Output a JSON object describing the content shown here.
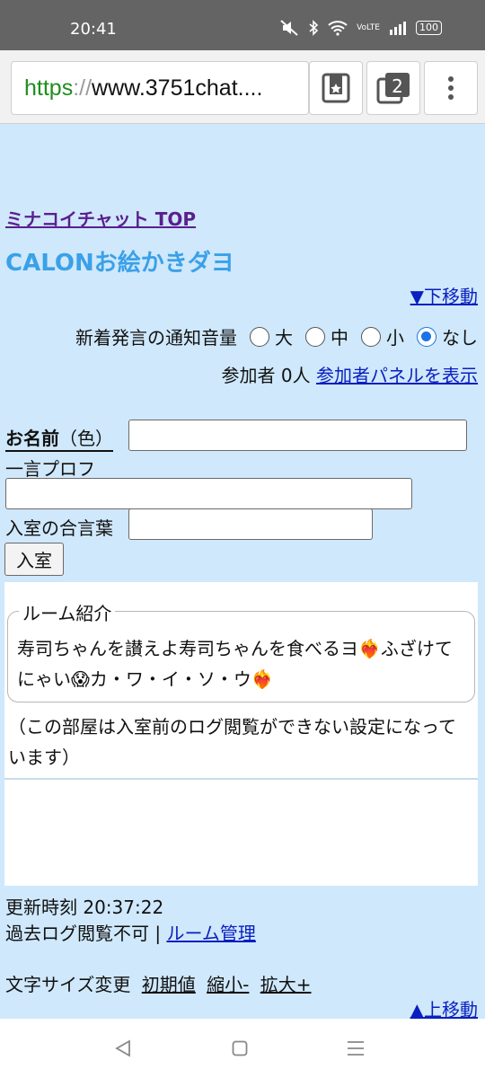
{
  "status_bar": {
    "time": "20:41",
    "battery": "100",
    "icons": [
      "mute-icon",
      "bluetooth-icon",
      "wifi-icon",
      "lte-icon",
      "signal-icon",
      "battery-icon"
    ]
  },
  "browser": {
    "url_scheme": "https",
    "url_sep": "://",
    "url_rest": "www.3751chat....",
    "tab_count": "2"
  },
  "page": {
    "top_link": "ミナコイチャット TOP",
    "room_title": "CALONお絵かきダヨ",
    "down_link": "▼下移動",
    "notify_label": "新着発言の通知音量",
    "volume_options": [
      "大",
      "中",
      "小",
      "なし"
    ],
    "volume_selected": "なし",
    "participants_text": "参加者 0人",
    "participants_link": "参加者パネルを表示",
    "name_label_bold": "お名前",
    "name_label_color": "（色）",
    "name_value": "",
    "prof_label": "一言プロフ",
    "prof_value": "",
    "password_label": "入室の合言葉",
    "password_value": "",
    "enter_button": "入室",
    "room_intro_legend": "ルーム紹介",
    "room_intro_text": "寿司ちゃんを讃えよ寿司ちゃんを食べるヨ❤️‍🔥ふざけてにゃい😱カ・ワ・イ・ソ・ウ❤️‍🔥",
    "log_note": "（この部屋は入室前のログ閲覧ができない設定になっています）",
    "updated_text": "更新時刻 20:37:22",
    "log_text": "過去ログ閲覧不可 | ",
    "room_admin_link": "ルーム管理",
    "font_size_label": "文字サイズ変更",
    "font_size_reset": "初期値",
    "font_size_smaller": "縮小-",
    "font_size_larger": "拡大+",
    "up_link": "▲上移動"
  },
  "colors": {
    "page_bg": "#cfe8fb",
    "title_blue": "#3aa1e8",
    "link_blue": "#0a1fbf",
    "visited_purple": "#5a1f8f",
    "radio_blue": "#1a73e8"
  }
}
